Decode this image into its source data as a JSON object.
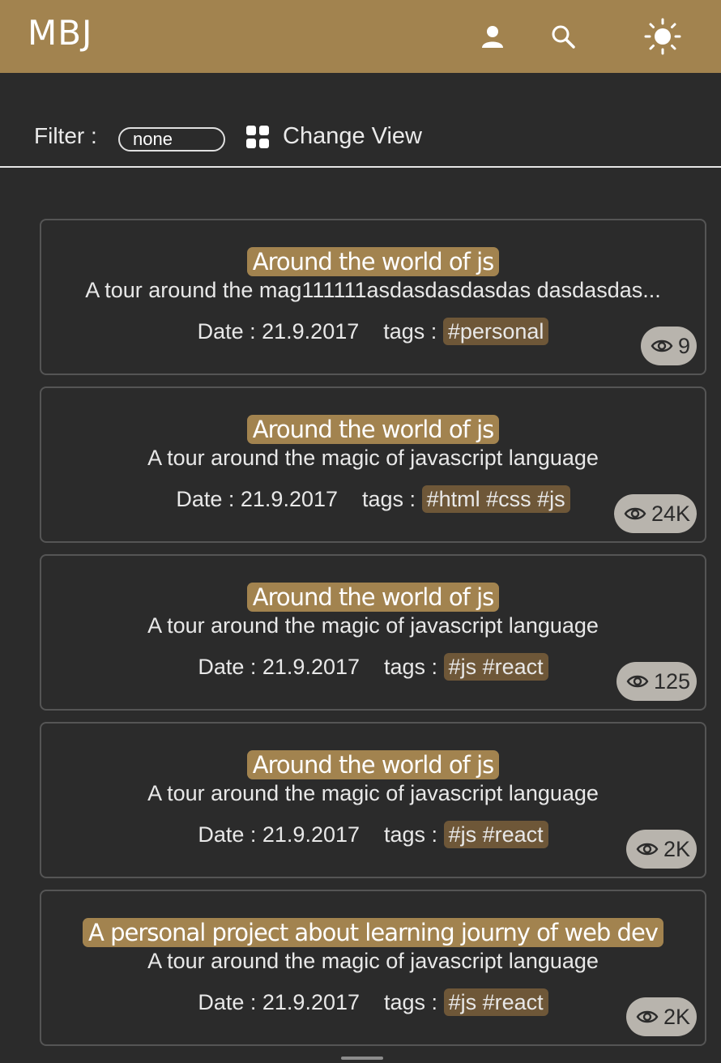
{
  "header": {
    "brand": "MBJ",
    "icons": [
      "user-icon",
      "search-icon",
      "sun-icon"
    ],
    "bg_color": "#a2834f"
  },
  "filter": {
    "label": "Filter :",
    "value": "none",
    "change_view_label": "Change View"
  },
  "posts": [
    {
      "title": "Around the world of js",
      "description": "A tour around the mag111111asdasdasdasdas dasdasdas...",
      "date_label": "Date : 21.9.2017",
      "tags_label": "tags :",
      "tags": "#personal",
      "views": "9"
    },
    {
      "title": "Around the world of js",
      "description": "A tour around the magic of javascript language",
      "date_label": "Date : 21.9.2017",
      "tags_label": "tags :",
      "tags": "#html #css #js",
      "views": "24K"
    },
    {
      "title": "Around the world of js",
      "description": "A tour around the magic of javascript language",
      "date_label": "Date : 21.9.2017",
      "tags_label": "tags :",
      "tags": "#js #react",
      "views": "125"
    },
    {
      "title": "Around the world of js",
      "description": "A tour around the magic of javascript language",
      "date_label": "Date : 21.9.2017",
      "tags_label": "tags :",
      "tags": "#js #react",
      "views": "2K"
    },
    {
      "title": "A personal project about learning journy of web dev",
      "description": "A tour around the magic of javascript language",
      "date_label": "Date : 21.9.2017",
      "tags_label": "tags :",
      "tags": "#js #react",
      "views": "2K"
    }
  ]
}
